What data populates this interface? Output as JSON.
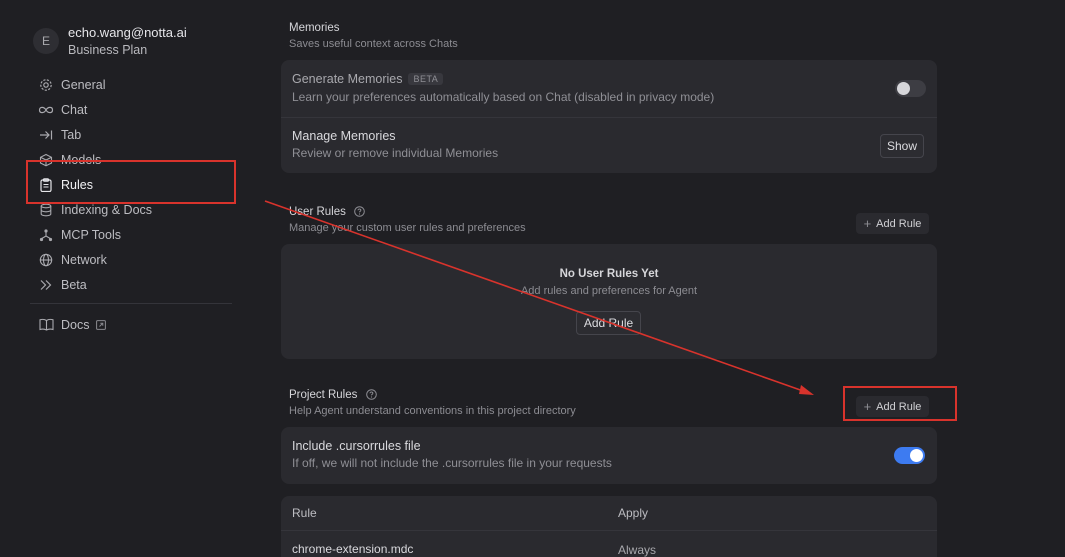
{
  "account": {
    "avatar_initial": "E",
    "email": "echo.wang@notta.ai",
    "plan": "Business Plan"
  },
  "sidebar": {
    "items": [
      {
        "label": "General",
        "icon": "gear-icon"
      },
      {
        "label": "Chat",
        "icon": "infinity-icon"
      },
      {
        "label": "Tab",
        "icon": "tab-arrow-icon"
      },
      {
        "label": "Models",
        "icon": "cube-icon"
      },
      {
        "label": "Rules",
        "icon": "clipboard-icon",
        "active": true
      },
      {
        "label": "Indexing & Docs",
        "icon": "database-icon"
      },
      {
        "label": "MCP Tools",
        "icon": "mcp-nodes-icon"
      },
      {
        "label": "Network",
        "icon": "globe-icon"
      },
      {
        "label": "Beta",
        "icon": "double-chevron-icon"
      }
    ],
    "docs_label": "Docs"
  },
  "memories": {
    "title": "Memories",
    "subtitle": "Saves useful context across Chats",
    "generate_title": "Generate Memories",
    "generate_badge": "BETA",
    "generate_desc": "Learn your preferences automatically based on Chat (disabled in privacy mode)",
    "generate_enabled": false,
    "manage_title": "Manage Memories",
    "manage_desc": "Review or remove individual Memories",
    "show_button": "Show"
  },
  "user_rules": {
    "title": "User Rules",
    "subtitle": "Manage your custom user rules and preferences",
    "add_rule_label": "Add Rule",
    "empty_title": "No User Rules Yet",
    "empty_desc": "Add rules and preferences for Agent",
    "empty_button": "Add Rule"
  },
  "project_rules": {
    "title": "Project Rules",
    "subtitle": "Help Agent understand conventions in this project directory",
    "add_rule_label": "Add Rule",
    "include_title": "Include .cursorrules file",
    "include_desc": "If off, we will not include the .cursorrules file in your requests",
    "include_enabled": true,
    "table": {
      "columns": [
        "Rule",
        "Apply"
      ],
      "rows": [
        {
          "rule": "chrome-extension.mdc",
          "apply": "Always"
        }
      ]
    }
  },
  "colors": {
    "annotation_red": "#d8332c",
    "toggle_on": "#3d7bf1",
    "background": "#1f1f23"
  }
}
